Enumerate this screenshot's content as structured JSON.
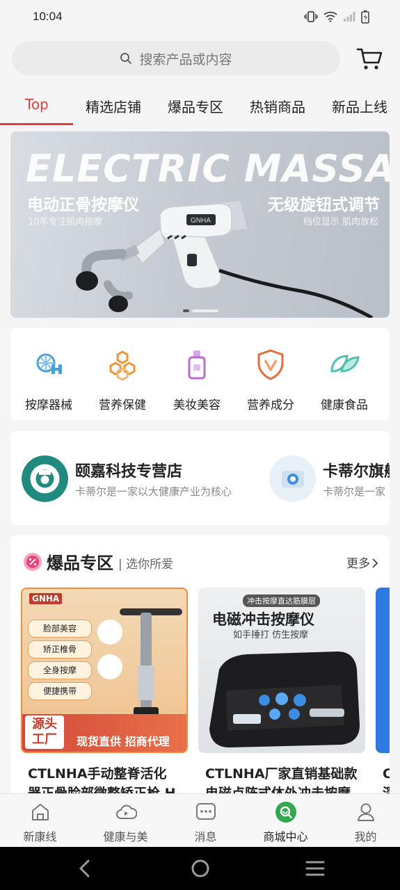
{
  "status_bar": {
    "time": "10:04"
  },
  "search": {
    "placeholder": "搜索产品或内容"
  },
  "tabs": [
    {
      "label": "Top",
      "active": true
    },
    {
      "label": "精选店铺"
    },
    {
      "label": "爆品专区"
    },
    {
      "label": "热销商品"
    },
    {
      "label": "新品上线"
    }
  ],
  "banner": {
    "headline": "ELECTRIC MASSAGE",
    "left_title": "电动正骨按摩仪",
    "left_sub": "10年专注肌肉按摩",
    "right_title": "无级旋钮式调节",
    "right_sub": "档位显示 肌肉放松",
    "gun_brand": "GNHA"
  },
  "categories": [
    {
      "label": "按摩器械",
      "icon": "massage-equipment-icon"
    },
    {
      "label": "营养保健",
      "icon": "nutrition-icon"
    },
    {
      "label": "美妆美容",
      "icon": "cosmetics-icon"
    },
    {
      "label": "营养成分",
      "icon": "nutrient-shield-icon"
    },
    {
      "label": "健康食品",
      "icon": "health-food-leaf-icon"
    }
  ],
  "stores": [
    {
      "name": "颐嘉科技专营店",
      "desc": "卡蒂尔是一家以大健康产业为核心"
    },
    {
      "name": "卡蒂尔旗舰",
      "desc": "卡蒂尔是一家"
    }
  ],
  "hot_section": {
    "title": "爆品专区",
    "subtitle": "| 选你所爱",
    "more": "更多",
    "products": [
      {
        "title": "CTLNHA手动整脊活化",
        "title_line2": "器正骨脸部微整矫正枪 H",
        "img": {
          "brand": "GNHA",
          "tags": [
            "脸部美容",
            "矫正椎骨",
            "全身按摩",
            "便捷携带"
          ],
          "corner": "源头工厂",
          "footer": "现货直供 招商代理"
        }
      },
      {
        "title": "CTLNHA厂家直销基础款",
        "title_line2": "电磁点阵式体外冲击按摩",
        "img": {
          "top_tag": "冲击按摩直达筋膜层",
          "headline": "电磁冲击按摩仪",
          "sub": "如手捶打 仿生按摩"
        }
      },
      {
        "title": "C",
        "title_line2": "深"
      }
    ]
  },
  "bottom_nav": [
    {
      "label": "新康线",
      "icon": "home-icon"
    },
    {
      "label": "健康与美",
      "icon": "cloud-play-icon"
    },
    {
      "label": "消息",
      "icon": "message-icon"
    },
    {
      "label": "商城中心",
      "icon": "mall-icon",
      "active": true
    },
    {
      "label": "我的",
      "icon": "profile-icon"
    }
  ],
  "colors": {
    "accent": "#e23c3c",
    "active_nav": "#2fa84f"
  }
}
